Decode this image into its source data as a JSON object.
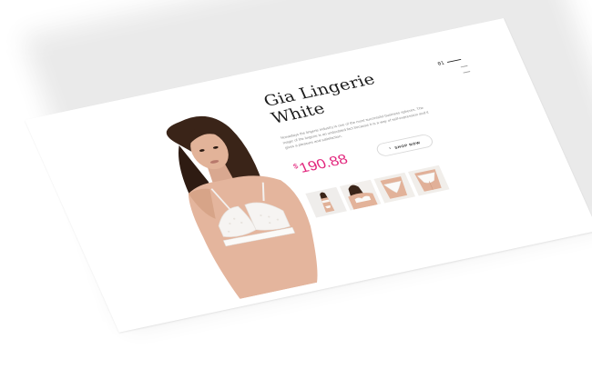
{
  "product": {
    "title_line1": "Gia Lingerie",
    "title_line2": "White",
    "description": "Nowadays the lingerie industry is one of the most successful business spheres. The magic of the lingerie is an undoubted fact because it is a way of self-expression and it gives a pleasure and satisfaction.",
    "currency": "$",
    "price": "190.88",
    "shop_button_label": "SHOP NOW",
    "accent_color": "#e2267d"
  },
  "pager": {
    "current": "01"
  },
  "thumbnails": [
    {
      "name": "full-body-thumbnail"
    },
    {
      "name": "bralette-model-thumbnail"
    },
    {
      "name": "panty-front-thumbnail"
    },
    {
      "name": "panty-back-thumbnail"
    }
  ]
}
